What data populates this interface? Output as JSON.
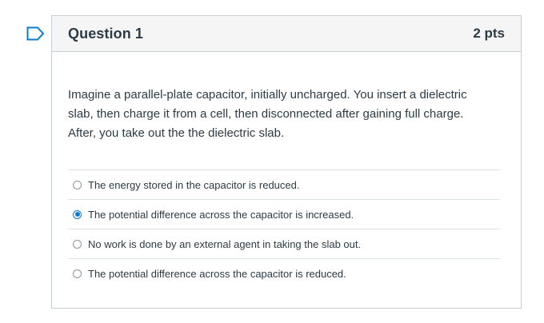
{
  "question": {
    "title": "Question 1",
    "points": "2 pts",
    "text": "Imagine a parallel-plate capacitor, initially uncharged. You insert a dielectric slab, then charge it from a cell, then disconnected after gaining full charge. After, you take out the the dielectric slab.",
    "answers": [
      {
        "label": "The energy stored in the capacitor is reduced.",
        "selected": false
      },
      {
        "label": "The potential difference across the capacitor is increased.",
        "selected": true
      },
      {
        "label": "No work is done by an external agent in taking the slab out.",
        "selected": false
      },
      {
        "label": "The potential difference across the capacitor is reduced.",
        "selected": false
      }
    ]
  },
  "colors": {
    "accent": "#0a7bd1",
    "text": "#2d3b45",
    "header_bg": "#f5f5f5",
    "border": "#c7cdd1"
  },
  "icons": {
    "flag": "flag-outline-icon"
  }
}
